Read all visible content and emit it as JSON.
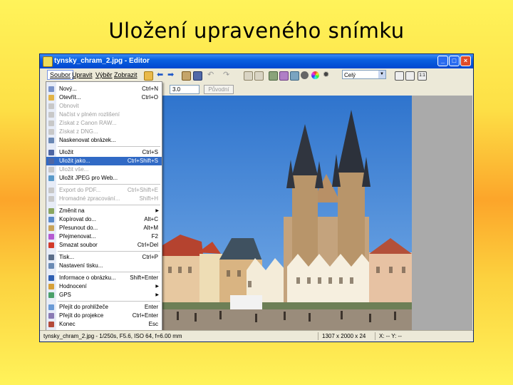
{
  "slide": {
    "title": "Uložení upraveného snímku"
  },
  "window": {
    "title": "tynsky_chram_2.jpg - Editor",
    "buttons": {
      "minimize": "_",
      "maximize": "□",
      "close": "×"
    }
  },
  "menubar": [
    "Soubor",
    "Upravit",
    "Výběr",
    "Zobrazit"
  ],
  "toolbar": {
    "combo_value": "Celý",
    "zoom_value": "3.0",
    "original_button": "Původní"
  },
  "file_menu": {
    "items": [
      {
        "label": "Nový...",
        "shortcut": "Ctrl+N",
        "icon": "new-file-icon",
        "disabled": false
      },
      {
        "label": "Otevřít...",
        "shortcut": "Ctrl+O",
        "icon": "open-folder-icon",
        "disabled": false
      },
      {
        "label": "Obnovit",
        "shortcut": "",
        "icon": "reload-icon",
        "disabled": true
      },
      {
        "label": "Načíst v plném rozlišení",
        "shortcut": "",
        "icon": "full-resolution-icon",
        "disabled": true
      },
      {
        "label": "Získat z Canon RAW...",
        "shortcut": "",
        "icon": "raw-icon",
        "disabled": true
      },
      {
        "label": "Získat z DNG...",
        "shortcut": "",
        "icon": "dng-icon",
        "disabled": true
      },
      {
        "label": "Naskenovat obrázek...",
        "shortcut": "",
        "icon": "scanner-icon",
        "disabled": false
      },
      {
        "sep": true
      },
      {
        "label": "Uložit",
        "shortcut": "Ctrl+S",
        "icon": "save-icon",
        "disabled": false
      },
      {
        "label": "Uložit jako...",
        "shortcut": "Ctrl+Shift+S",
        "icon": "save-as-icon",
        "disabled": false,
        "highlight": true
      },
      {
        "label": "Uložit vše...",
        "shortcut": "",
        "icon": "save-all-icon",
        "disabled": true
      },
      {
        "label": "Uložit JPEG pro Web...",
        "shortcut": "",
        "icon": "web-jpeg-icon",
        "disabled": false
      },
      {
        "sep": true
      },
      {
        "label": "Export do PDF...",
        "shortcut": "Ctrl+Shift+E",
        "icon": "pdf-icon",
        "disabled": true
      },
      {
        "label": "Hromadné zpracování...",
        "shortcut": "Shift+H",
        "icon": "batch-icon",
        "disabled": true
      },
      {
        "sep": true
      },
      {
        "label": "Změnit na",
        "shortcut": "",
        "icon": "convert-icon",
        "disabled": false,
        "submenu": true
      },
      {
        "label": "Kopírovat do...",
        "shortcut": "Alt+C",
        "icon": "copy-to-icon",
        "disabled": false
      },
      {
        "label": "Přesunout do...",
        "shortcut": "Alt+M",
        "icon": "move-to-icon",
        "disabled": false
      },
      {
        "label": "Přejmenovat...",
        "shortcut": "F2",
        "icon": "rename-icon",
        "disabled": false
      },
      {
        "label": "Smazat soubor",
        "shortcut": "Ctrl+Del",
        "icon": "delete-icon",
        "disabled": false
      },
      {
        "sep": true
      },
      {
        "label": "Tisk...",
        "shortcut": "Ctrl+P",
        "icon": "print-icon",
        "disabled": false
      },
      {
        "label": "Nastavení tisku...",
        "shortcut": "",
        "icon": "print-setup-icon",
        "disabled": false
      },
      {
        "sep": true
      },
      {
        "label": "Informace o obrázku...",
        "shortcut": "Shift+Enter",
        "icon": "info-icon",
        "disabled": false
      },
      {
        "label": "Hodnocení",
        "shortcut": "",
        "icon": "rating-icon",
        "disabled": false,
        "submenu": true
      },
      {
        "label": "GPS",
        "shortcut": "",
        "icon": "gps-icon",
        "disabled": false,
        "submenu": true
      },
      {
        "sep": true
      },
      {
        "label": "Přejít do prohlížeče",
        "shortcut": "Enter",
        "icon": "browser-icon",
        "disabled": false
      },
      {
        "label": "Přejít do projekce",
        "shortcut": "Ctrl+Enter",
        "icon": "slideshow-icon",
        "disabled": false
      },
      {
        "label": "Konec",
        "shortcut": "Esc",
        "icon": "exit-icon",
        "disabled": false
      }
    ]
  },
  "statusbar": {
    "file_info": "tynsky_chram_2.jpg - 1/250s, F5.6, ISO 64, f=6.00 mm",
    "dimensions": "1307 x 2000 x 24",
    "zoom": "X: --  Y: --"
  },
  "colors": {
    "titlebar": "#0a5fe0",
    "menu_highlight": "#316ac5",
    "sky": "#3e83d3"
  }
}
